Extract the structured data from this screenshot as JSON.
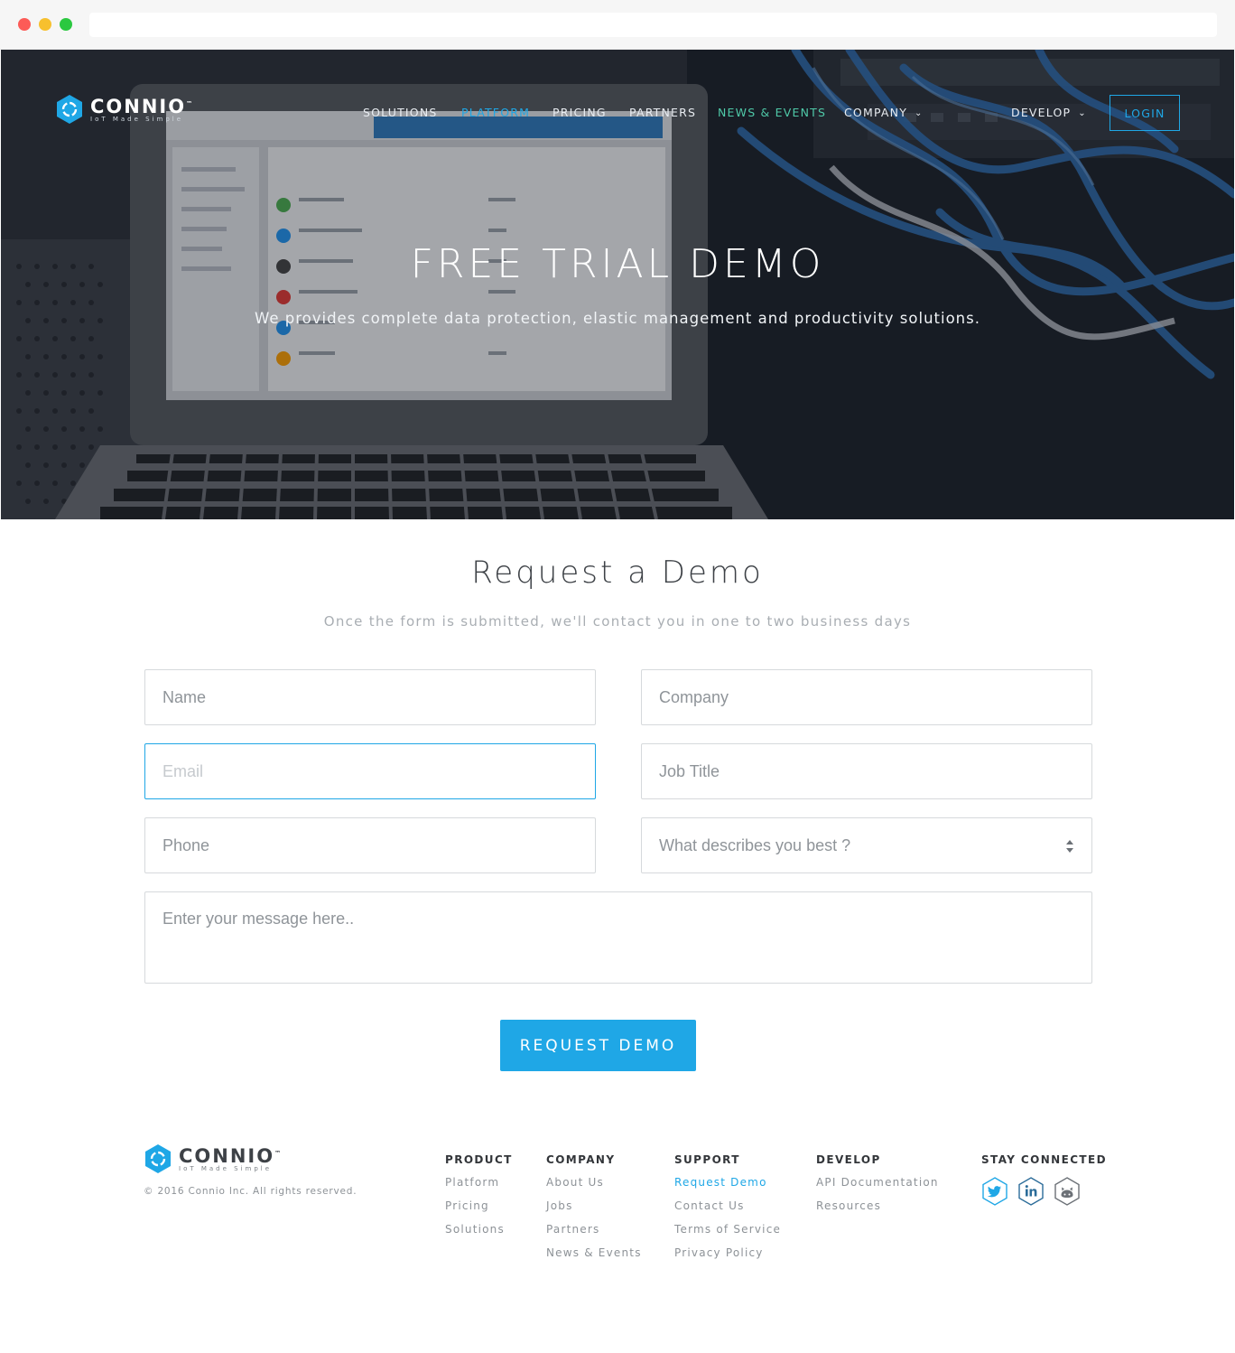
{
  "brand": {
    "name": "CONNIO",
    "tm": "™",
    "tagline": "IoT Made Simple",
    "accent": "#1fa7e6"
  },
  "nav": {
    "items": [
      {
        "label": "SOLUTIONS"
      },
      {
        "label": "PLATFORM"
      },
      {
        "label": "PRICING"
      },
      {
        "label": "PARTNERS"
      },
      {
        "label": "NEWS & EVENTS"
      },
      {
        "label": "COMPANY"
      }
    ],
    "develop": "DEVELOP",
    "login": "LOGIN"
  },
  "hero": {
    "title": "FREE TRIAL DEMO",
    "subtitle": "We provides complete data protection, elastic management and productivity solutions."
  },
  "form": {
    "title": "Request a Demo",
    "subtitle": "Once the form is submitted, we'll contact you in one to two business days",
    "name_placeholder": "Name",
    "company_placeholder": "Company",
    "email_placeholder": "Email",
    "job_title_placeholder": "Job Title",
    "phone_placeholder": "Phone",
    "describe_select": "What describes you best ?",
    "message_placeholder": "Enter your message here..",
    "submit_label": "REQUEST DEMO"
  },
  "footer": {
    "copyright": "© 2016 Connio Inc. All rights reserved.",
    "columns": [
      {
        "heading": "PRODUCT",
        "links": [
          "Platform",
          "Pricing",
          "Solutions"
        ]
      },
      {
        "heading": "COMPANY",
        "links": [
          "About Us",
          "Jobs",
          "Partners",
          "News & Events"
        ]
      },
      {
        "heading": "SUPPORT",
        "links": [
          "Request Demo",
          "Contact Us",
          "Terms of Service",
          "Privacy Policy"
        ]
      },
      {
        "heading": "DEVELOP",
        "links": [
          "API Documentation",
          "Resources"
        ]
      }
    ],
    "stay_connected": "STAY CONNECTED",
    "social_icons": [
      "twitter-icon",
      "linkedin-icon",
      "github-icon"
    ]
  }
}
